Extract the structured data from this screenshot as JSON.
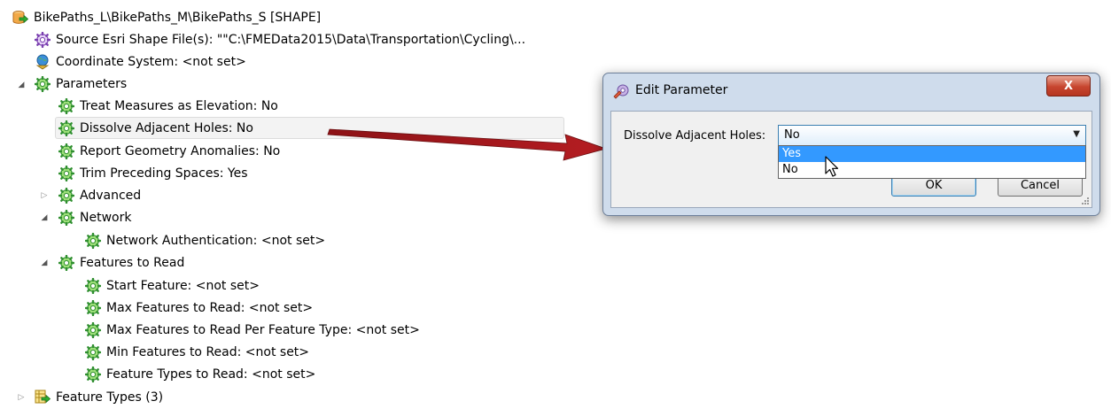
{
  "tree": {
    "root": {
      "label": "BikePaths_L\\BikePaths_M\\BikePaths_S [SHAPE]",
      "icon": "database-arrow-icon"
    },
    "source": {
      "label": "Source Esri Shape File(s): \"\"C:\\FMEData2015\\Data\\Transportation\\Cycling\\..."
    },
    "coordsys": {
      "label": "Coordinate System: <not set>",
      "icon": "globe-pin-icon"
    },
    "parameters": {
      "label": "Parameters"
    },
    "params": [
      {
        "label": "Treat Measures as Elevation: No"
      },
      {
        "label": "Dissolve Adjacent Holes: No"
      },
      {
        "label": "Report Geometry Anomalies: No"
      },
      {
        "label": "Trim Preceding Spaces: Yes"
      }
    ],
    "advanced": {
      "label": "Advanced"
    },
    "network": {
      "label": "Network"
    },
    "network_auth": {
      "label": "Network Authentication: <not set>"
    },
    "features_to_read": {
      "label": "Features to Read"
    },
    "ftr_items": [
      {
        "label": "Start Feature: <not set>"
      },
      {
        "label": "Max Features to Read: <not set>"
      },
      {
        "label": "Max Features to Read Per Feature Type: <not set>"
      },
      {
        "label": "Min Features to Read: <not set>"
      },
      {
        "label": "Feature Types to Read: <not set>"
      }
    ],
    "feature_types": {
      "label": "Feature Types (3)"
    }
  },
  "dialog": {
    "title": "Edit Parameter",
    "close_label": "X",
    "field_label": "Dissolve Adjacent Holes:",
    "value": "No",
    "options": [
      "Yes",
      "No"
    ],
    "highlighted_option": "Yes",
    "ok_label": "OK",
    "cancel_label": "Cancel"
  },
  "colors": {
    "gear": "#35a835",
    "highlight": "#3399ff",
    "arrow": "#a4161a"
  }
}
